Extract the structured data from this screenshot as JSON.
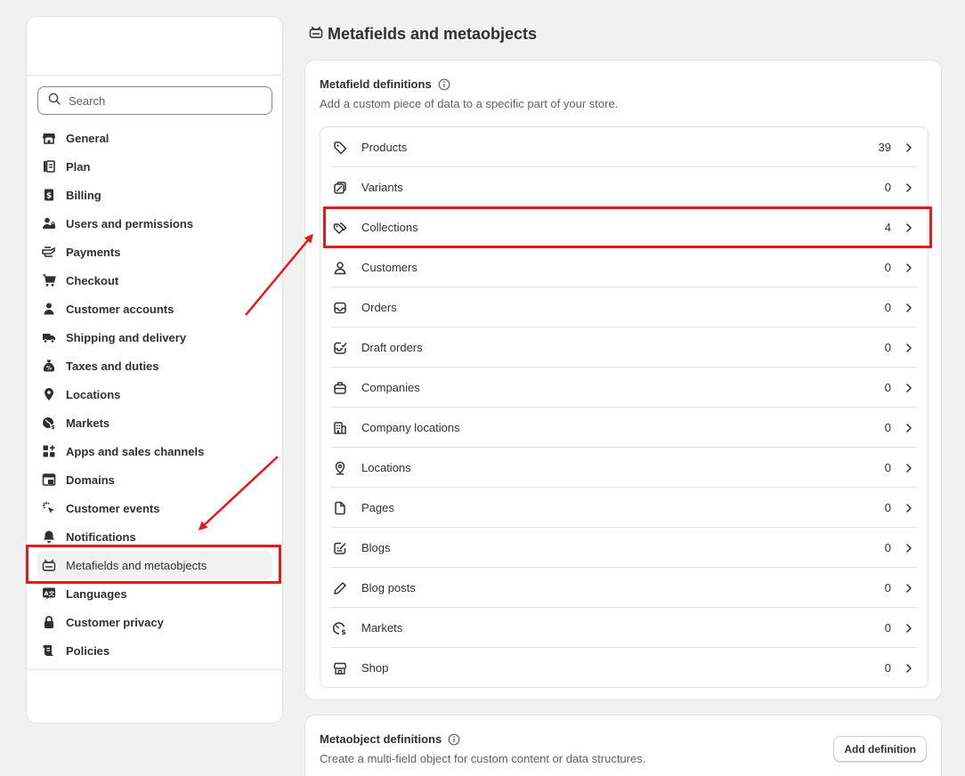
{
  "sidebar": {
    "search_placeholder": "Search",
    "items": [
      {
        "label": "General",
        "icon": "store-icon"
      },
      {
        "label": "Plan",
        "icon": "plan-icon"
      },
      {
        "label": "Billing",
        "icon": "billing-icon"
      },
      {
        "label": "Users and permissions",
        "icon": "users-icon"
      },
      {
        "label": "Payments",
        "icon": "payments-icon"
      },
      {
        "label": "Checkout",
        "icon": "cart-icon"
      },
      {
        "label": "Customer accounts",
        "icon": "person-icon"
      },
      {
        "label": "Shipping and delivery",
        "icon": "truck-icon"
      },
      {
        "label": "Taxes and duties",
        "icon": "tax-bag-icon"
      },
      {
        "label": "Locations",
        "icon": "location-pin-icon"
      },
      {
        "label": "Markets",
        "icon": "globe-icon"
      },
      {
        "label": "Apps and sales channels",
        "icon": "apps-icon"
      },
      {
        "label": "Domains",
        "icon": "domains-icon"
      },
      {
        "label": "Customer events",
        "icon": "cursor-icon"
      },
      {
        "label": "Notifications",
        "icon": "bell-icon"
      },
      {
        "label": "Metafields and metaobjects",
        "icon": "metafields-icon",
        "active": true
      },
      {
        "label": "Languages",
        "icon": "languages-icon"
      },
      {
        "label": "Customer privacy",
        "icon": "lock-icon"
      },
      {
        "label": "Policies",
        "icon": "policies-icon"
      }
    ]
  },
  "page": {
    "title": "Metafields and metaobjects"
  },
  "metafield_card": {
    "title": "Metafield definitions",
    "subtitle": "Add a custom piece of data to a specific part of your store.",
    "rows": [
      {
        "label": "Products",
        "count": "39",
        "icon": "tag-icon"
      },
      {
        "label": "Variants",
        "count": "0",
        "icon": "variants-icon"
      },
      {
        "label": "Collections",
        "count": "4",
        "icon": "collections-icon",
        "highlighted": true
      },
      {
        "label": "Customers",
        "count": "0",
        "icon": "person-outline-icon"
      },
      {
        "label": "Orders",
        "count": "0",
        "icon": "inbox-icon"
      },
      {
        "label": "Draft orders",
        "count": "0",
        "icon": "draft-order-icon"
      },
      {
        "label": "Companies",
        "count": "0",
        "icon": "briefcase-icon"
      },
      {
        "label": "Company locations",
        "count": "0",
        "icon": "building-icon"
      },
      {
        "label": "Locations",
        "count": "0",
        "icon": "location-outline-icon"
      },
      {
        "label": "Pages",
        "count": "0",
        "icon": "page-icon"
      },
      {
        "label": "Blogs",
        "count": "0",
        "icon": "blog-icon"
      },
      {
        "label": "Blog posts",
        "count": "0",
        "icon": "pencil-icon"
      },
      {
        "label": "Markets",
        "count": "0",
        "icon": "globe-outline-icon"
      },
      {
        "label": "Shop",
        "count": "0",
        "icon": "shop-icon"
      }
    ]
  },
  "metaobject_card": {
    "title": "Metaobject definitions",
    "subtitle": "Create a multi-field object for custom content or data structures.",
    "add_button": "Add definition"
  },
  "colors": {
    "annotation": "#e4191b",
    "background": "#f1f1f1",
    "text": "#303030"
  }
}
